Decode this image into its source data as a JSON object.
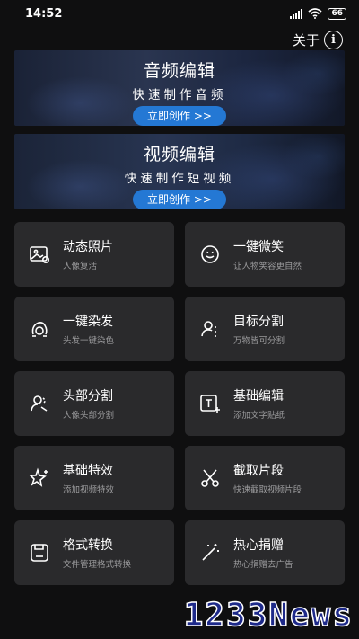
{
  "status_bar": {
    "time": "14:52",
    "battery": "66"
  },
  "header": {
    "about_label": "关于",
    "about_icon": "info-icon"
  },
  "banners": [
    {
      "title": "音频编辑",
      "subtitle": "快速制作音频",
      "button": "立即创作 >>"
    },
    {
      "title": "视频编辑",
      "subtitle": "快速制作短视频",
      "button": "立即创作 >>"
    }
  ],
  "features": [
    {
      "title": "动态照片",
      "subtitle": "人像复活",
      "icon": "photo-icon"
    },
    {
      "title": "一键微笑",
      "subtitle": "让人物笑容更自然",
      "icon": "smile-icon"
    },
    {
      "title": "一键染发",
      "subtitle": "头发一键染色",
      "icon": "hair-icon"
    },
    {
      "title": "目标分割",
      "subtitle": "万物皆可分割",
      "icon": "segment-icon"
    },
    {
      "title": "头部分割",
      "subtitle": "人像头部分割",
      "icon": "head-segment-icon"
    },
    {
      "title": "基础编辑",
      "subtitle": "添加文字贴纸",
      "icon": "text-edit-icon"
    },
    {
      "title": "基础特效",
      "subtitle": "添加视频特效",
      "icon": "sparkle-icon"
    },
    {
      "title": "截取片段",
      "subtitle": "快速截取视频片段",
      "icon": "scissors-icon"
    },
    {
      "title": "格式转换",
      "subtitle": "文件管理格式转换",
      "icon": "save-icon"
    },
    {
      "title": "热心捐赠",
      "subtitle": "热心捐赠去广告",
      "icon": "magic-wand-icon"
    }
  ],
  "watermark": "1233News",
  "colors": {
    "background": "#0f0f10",
    "card": "#2a2a2c",
    "button": "#2478d4"
  }
}
